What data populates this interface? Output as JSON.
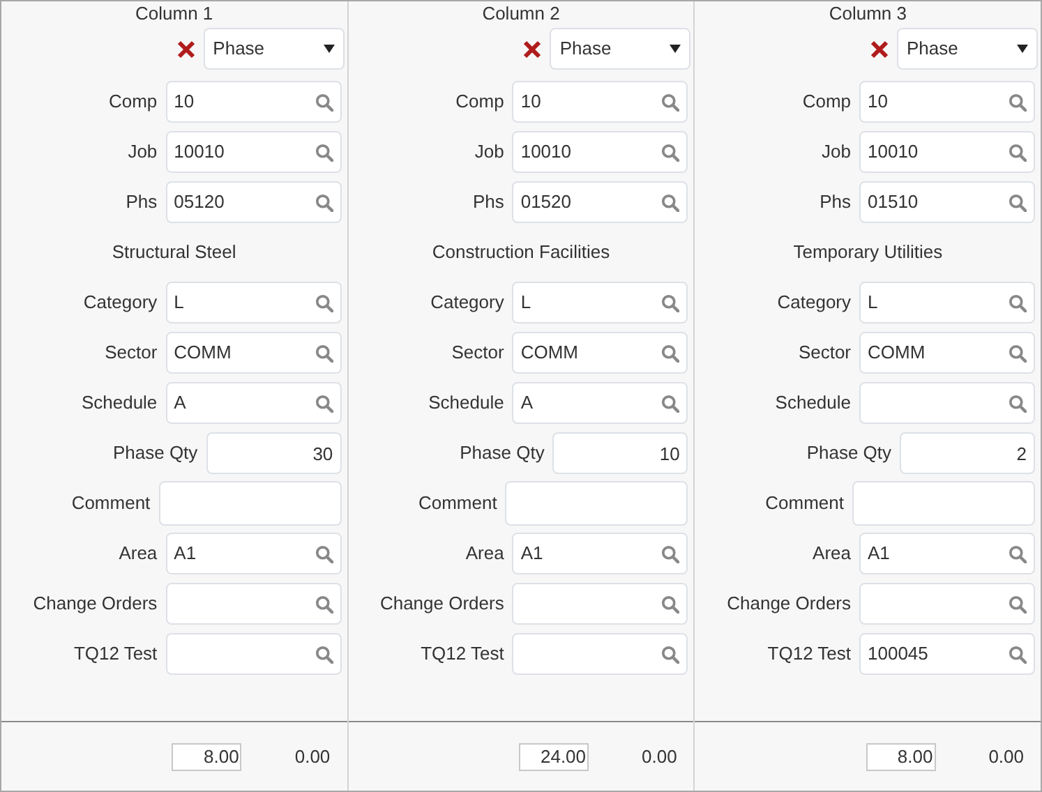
{
  "columns": [
    {
      "title": "Column 1",
      "select": "Phase",
      "rows": [
        {
          "kind": "lookup",
          "label": "Comp",
          "value": "10"
        },
        {
          "kind": "lookup",
          "label": "Job",
          "value": "10010"
        },
        {
          "kind": "lookup",
          "label": "Phs",
          "value": "05120"
        },
        {
          "kind": "heading",
          "label": "Structural Steel"
        },
        {
          "kind": "lookup",
          "label": "Category",
          "value": "L"
        },
        {
          "kind": "lookup",
          "label": "Sector",
          "value": "COMM"
        },
        {
          "kind": "lookup",
          "label": "Schedule",
          "value": "A"
        },
        {
          "kind": "number",
          "label": "Phase Qty",
          "value": "30"
        },
        {
          "kind": "text",
          "label": "Comment"
        },
        {
          "kind": "lookup",
          "label": "Area",
          "value": "A1"
        },
        {
          "kind": "lookup",
          "label": "Change Orders"
        },
        {
          "kind": "lookup",
          "label": "TQ12 Test"
        }
      ],
      "footer": {
        "amount": "8.00",
        "total": "0.00"
      }
    },
    {
      "title": "Column 2",
      "select": "Phase",
      "rows": [
        {
          "kind": "lookup",
          "label": "Comp",
          "value": "10"
        },
        {
          "kind": "lookup",
          "label": "Job",
          "value": "10010"
        },
        {
          "kind": "lookup",
          "label": "Phs",
          "value": "01520"
        },
        {
          "kind": "heading",
          "label": "Construction Facilities"
        },
        {
          "kind": "lookup",
          "label": "Category",
          "value": "L"
        },
        {
          "kind": "lookup",
          "label": "Sector",
          "value": "COMM"
        },
        {
          "kind": "lookup",
          "label": "Schedule",
          "value": "A"
        },
        {
          "kind": "number",
          "label": "Phase Qty",
          "value": "10"
        },
        {
          "kind": "text",
          "label": "Comment"
        },
        {
          "kind": "lookup",
          "label": "Area",
          "value": "A1"
        },
        {
          "kind": "lookup",
          "label": "Change Orders"
        },
        {
          "kind": "lookup",
          "label": "TQ12 Test"
        }
      ],
      "footer": {
        "amount": "24.00",
        "total": "0.00"
      }
    },
    {
      "title": "Column 3",
      "select": "Phase",
      "rows": [
        {
          "kind": "lookup",
          "label": "Comp",
          "value": "10"
        },
        {
          "kind": "lookup",
          "label": "Job",
          "value": "10010"
        },
        {
          "kind": "lookup",
          "label": "Phs",
          "value": "01510"
        },
        {
          "kind": "heading",
          "label": "Temporary Utilities"
        },
        {
          "kind": "lookup",
          "label": "Category",
          "value": "L"
        },
        {
          "kind": "lookup",
          "label": "Sector",
          "value": "COMM"
        },
        {
          "kind": "lookup",
          "label": "Schedule"
        },
        {
          "kind": "number",
          "label": "Phase Qty",
          "value": "2"
        },
        {
          "kind": "text",
          "label": "Comment"
        },
        {
          "kind": "lookup",
          "label": "Area",
          "value": "A1"
        },
        {
          "kind": "lookup",
          "label": "Change Orders"
        },
        {
          "kind": "lookup",
          "label": "TQ12 Test",
          "value": "100045"
        }
      ],
      "footer": {
        "amount": "8.00",
        "total": "0.00"
      }
    }
  ]
}
